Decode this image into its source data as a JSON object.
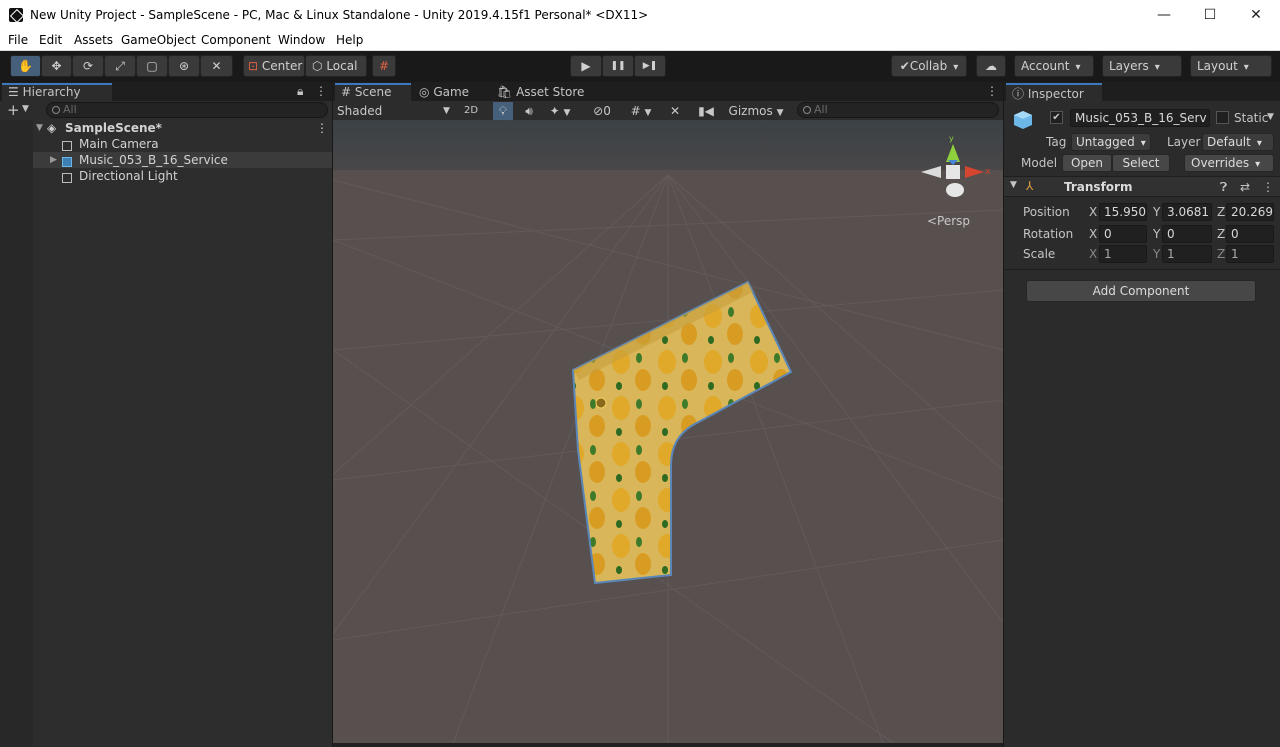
{
  "window": {
    "title": "New Unity Project - SampleScene - PC, Mac & Linux Standalone - Unity 2019.4.15f1 Personal* <DX11>",
    "minimize": "—",
    "maximize": "☐",
    "close": "✕"
  },
  "menu": [
    "File",
    "Edit",
    "Assets",
    "GameObject",
    "Component",
    "Window",
    "Help"
  ],
  "toolbar": {
    "pivot_label": "Center",
    "space_label": "Local",
    "collab_label": "Collab",
    "account_label": "Account",
    "layers_label": "Layers",
    "layout_label": "Layout",
    "play_icon": "▶",
    "pause_icon": "❚❚",
    "step_icon": "▶❚"
  },
  "hierarchy": {
    "tab_label": "Hierarchy",
    "add_label": "+",
    "search_placeholder": "All",
    "scene_name": "SampleScene*",
    "items": [
      "Main Camera",
      "Music_053_B_16_Service",
      "Directional Light"
    ]
  },
  "scene": {
    "tabs": [
      "Scene",
      "Game",
      "Asset Store"
    ],
    "shading_mode": "Shaded",
    "mode_2d": "2D",
    "hidden_count": "0",
    "gizmos_label": "Gizmos",
    "search_placeholder": "All",
    "persp_label": "<Persp",
    "gizmo_axes": {
      "y": "y",
      "x": "x"
    }
  },
  "inspector": {
    "tab_label": "Inspector",
    "object_name": "Music_053_B_16_Serv",
    "static_label": "Static",
    "tag_label": "Tag",
    "tag_value": "Untagged",
    "layer_label": "Layer",
    "layer_value": "Default",
    "model_label": "Model",
    "open_label": "Open",
    "select_label": "Select",
    "overrides_label": "Overrides",
    "transform_title": "Transform",
    "position_label": "Position",
    "rotation_label": "Rotation",
    "scale_label": "Scale",
    "axis_x": "X",
    "axis_y": "Y",
    "axis_z": "Z",
    "position": {
      "x": "15.950",
      "y": "3.0681",
      "z": "20.269"
    },
    "rotation": {
      "x": "0",
      "y": "0",
      "z": "0"
    },
    "scale": {
      "x": "1",
      "y": "1",
      "z": "1"
    },
    "add_component_label": "Add Component"
  },
  "colors": {
    "accent_blue": "#3a79bb",
    "panel_bg": "#282828",
    "scene_ground": "#57504f",
    "sky": "#3d4348"
  }
}
